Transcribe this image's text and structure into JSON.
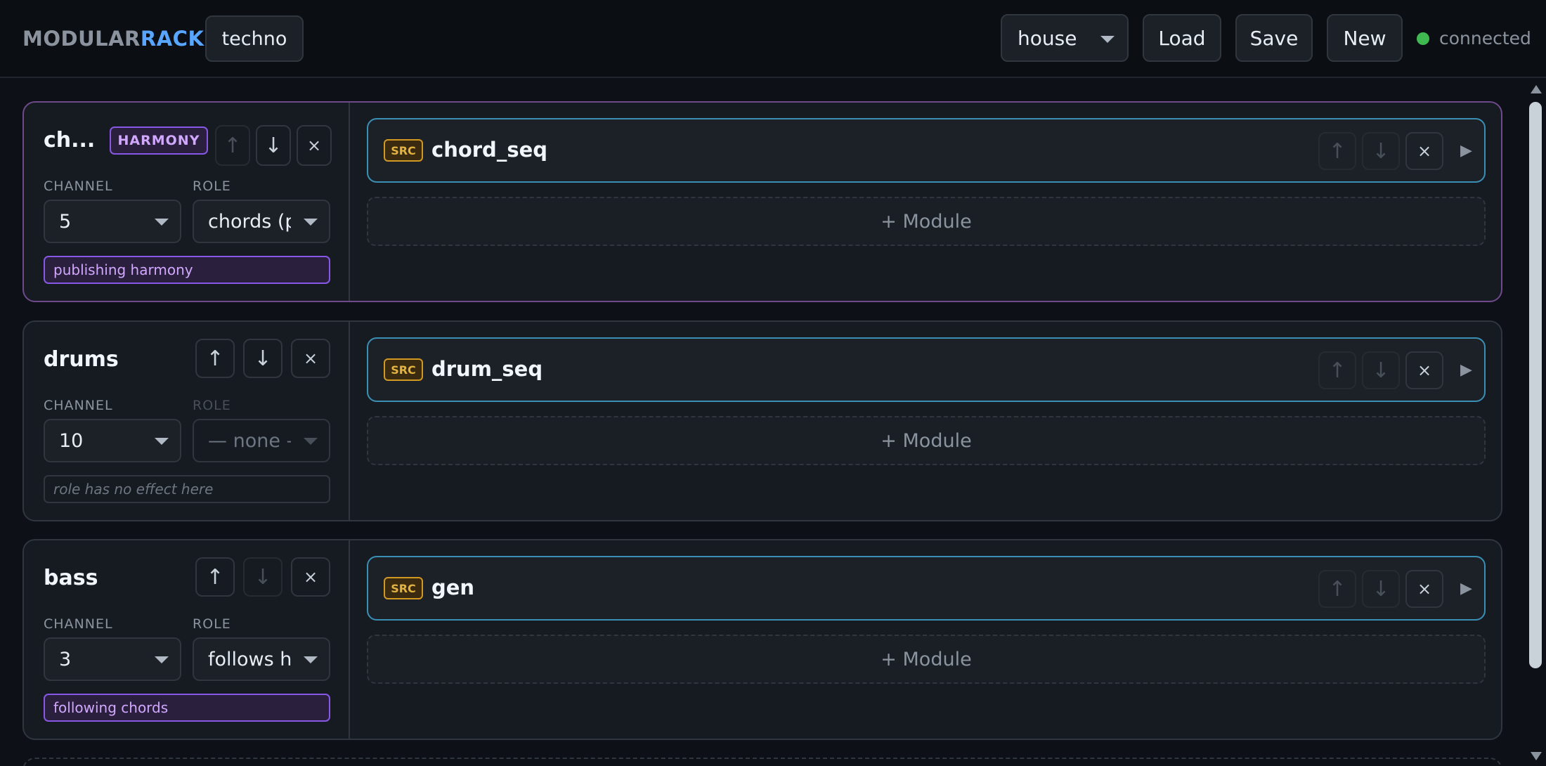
{
  "app": {
    "logo_part1": "MODULAR",
    "logo_part2": "RACK",
    "project_name": "techno"
  },
  "header": {
    "preset_value": "house",
    "load_label": "Load",
    "save_label": "Save",
    "new_label": "New",
    "status_text": "connected",
    "status_color": "#3fb950"
  },
  "labels": {
    "channel": "CHANNEL",
    "role": "ROLE",
    "add_module": "+ Module",
    "src_badge": "SRC",
    "harmony_badge": "HARMONY"
  },
  "icons": {
    "up": "↑",
    "down": "↓",
    "close": "×",
    "play": "▶"
  },
  "tracks": [
    {
      "name": "ch...",
      "channel": "5",
      "role": "chords (pu",
      "note": "publishing harmony",
      "module": "chord_seq"
    },
    {
      "name": "drums",
      "channel": "10",
      "role": "— none —",
      "note": "role has no effect here",
      "module": "drum_seq"
    },
    {
      "name": "bass",
      "channel": "3",
      "role": "follows ha",
      "note": "following chords",
      "module": "gen"
    }
  ]
}
